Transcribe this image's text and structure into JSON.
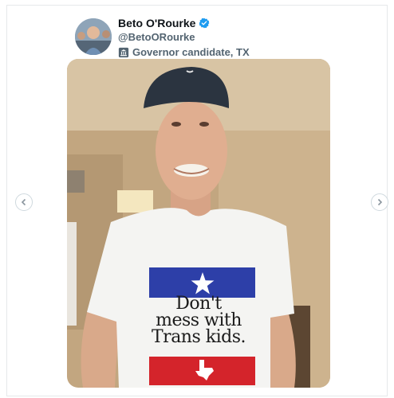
{
  "profile": {
    "name": "Beto O'Rourke",
    "handle": "@BetoORourke",
    "label": "Governor candidate, TX"
  },
  "icons": {
    "verified": "verified-badge-icon",
    "government": "government-building-icon",
    "prev": "chevron-left-icon",
    "next": "chevron-right-icon"
  },
  "photo": {
    "shirt_text": [
      "Don't",
      "mess with",
      "Trans kids."
    ]
  },
  "colors": {
    "verified": "#1d9bf0",
    "flag_blue": "#2d3fa8",
    "flag_red": "#d4242b",
    "wall": "#c9ad86",
    "cap": "#2b3440"
  }
}
